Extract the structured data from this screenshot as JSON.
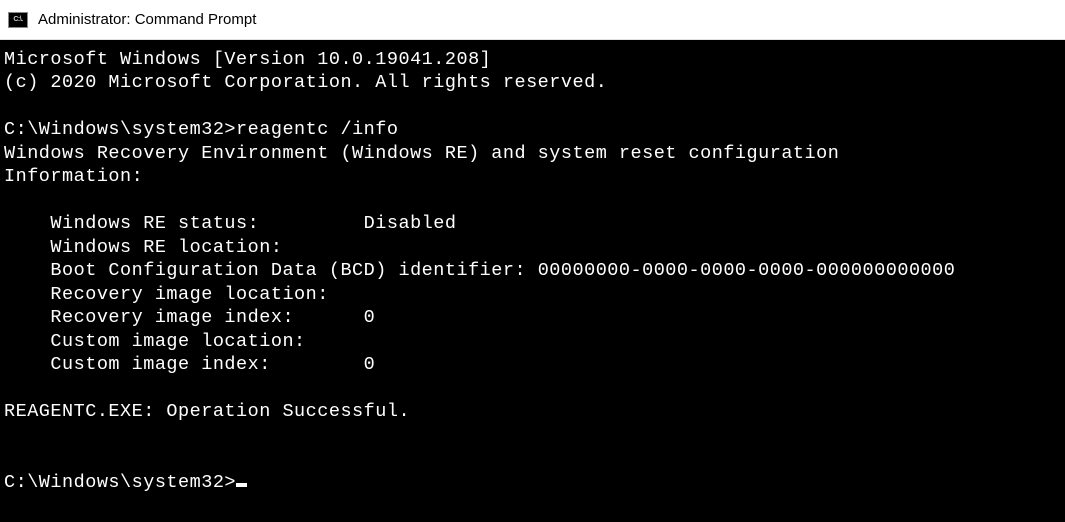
{
  "window": {
    "title": "Administrator: Command Prompt",
    "icon_label": "C:\\."
  },
  "terminal": {
    "header_line1": "Microsoft Windows [Version 10.0.19041.208]",
    "header_line2": "(c) 2020 Microsoft Corporation. All rights reserved.",
    "prompt1_path": "C:\\Windows\\system32>",
    "prompt1_command": "reagentc /info",
    "output_title_line1": "Windows Recovery Environment (Windows RE) and system reset configuration",
    "output_title_line2": "Information:",
    "info": {
      "re_status_label": "    Windows RE status:         ",
      "re_status_value": "Disabled",
      "re_location_label": "    Windows RE location:",
      "re_location_value": "",
      "bcd_label": "    Boot Configuration Data (BCD) identifier: ",
      "bcd_value": "00000000-0000-0000-0000-000000000000",
      "recovery_loc_label": "    Recovery image location:",
      "recovery_loc_value": "",
      "recovery_idx_label": "    Recovery image index:      ",
      "recovery_idx_value": "0",
      "custom_loc_label": "    Custom image location:",
      "custom_loc_value": "",
      "custom_idx_label": "    Custom image index:        ",
      "custom_idx_value": "0"
    },
    "result_line": "REAGENTC.EXE: Operation Successful.",
    "prompt2_path": "C:\\Windows\\system32>"
  }
}
